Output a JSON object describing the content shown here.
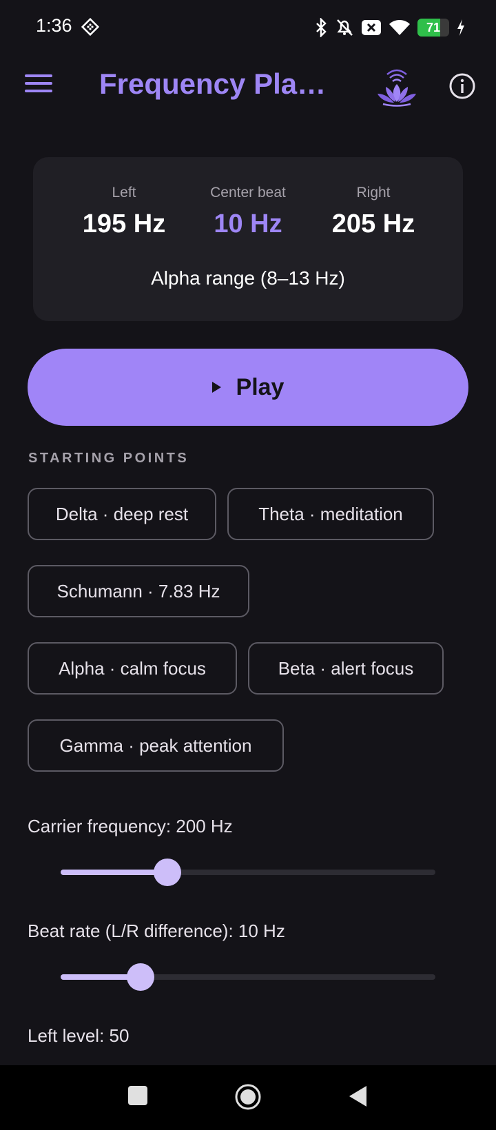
{
  "status_bar": {
    "time": "1:36",
    "battery_level": "71",
    "icons": [
      "assistant-icon",
      "bluetooth-icon",
      "notifications-off-icon",
      "close-box-icon",
      "wifi-icon",
      "battery-icon",
      "charging-icon"
    ]
  },
  "app_bar": {
    "title": "Frequency Play...",
    "menu_icon": "menu-icon",
    "logo_icon": "lotus-logo-icon",
    "info_icon": "info-icon"
  },
  "frequency_card": {
    "left_label": "Left",
    "left_value": "195 Hz",
    "center_label": "Center beat",
    "center_value": "10 Hz",
    "right_label": "Right",
    "right_value": "205 Hz",
    "range_text": "Alpha range (8–13 Hz)"
  },
  "play_button": {
    "label": "Play"
  },
  "starting_points": {
    "header": "STARTING POINTS",
    "chips": [
      "Delta · deep rest",
      "Theta · meditation",
      "Schumann · 7.83 Hz",
      "Alpha · calm focus",
      "Beta · alert focus",
      "Gamma · peak attention"
    ]
  },
  "sliders": {
    "carrier": {
      "label": "Carrier frequency: 200 Hz",
      "fraction": 0.285
    },
    "beat": {
      "label": "Beat rate (L/R difference): 10 Hz",
      "fraction": 0.213
    },
    "left_level": {
      "label": "Left level: 50",
      "fraction": 0.5
    }
  },
  "colors": {
    "background": "#141318",
    "accent": "#9e86f5",
    "play_button": "#a085f7",
    "slider_active": "#cdbef9",
    "card": "#201f25"
  }
}
